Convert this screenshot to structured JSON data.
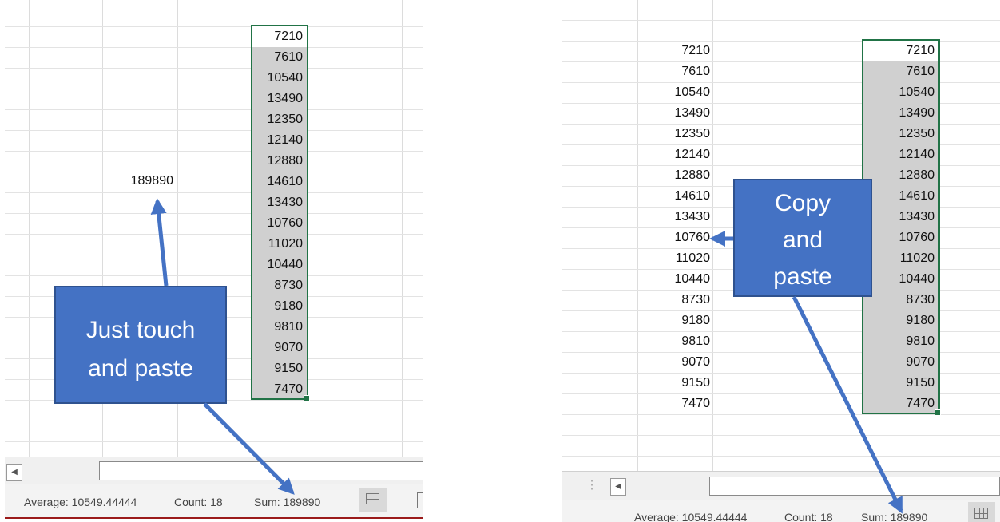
{
  "values": [
    "7210",
    "7610",
    "10540",
    "13490",
    "12350",
    "12140",
    "12880",
    "14610",
    "13430",
    "10760",
    "11020",
    "10440",
    "8730",
    "9180",
    "9810",
    "9070",
    "9150",
    "7470"
  ],
  "left": {
    "sum_cell": "189890",
    "callout": [
      "Just touch",
      "and paste"
    ],
    "status": {
      "average": "Average: 10549.44444",
      "count": "Count: 18",
      "sum": "Sum: 189890"
    }
  },
  "right": {
    "callout": [
      "Copy",
      "and",
      "paste"
    ],
    "status": {
      "average": "Average: 10549.44444",
      "count": "Count: 18",
      "sum": "Sum: 189890"
    }
  },
  "colors": {
    "callout_fill": "#4472c4",
    "arrow": "#4472c4",
    "selection_border": "#217346",
    "selected_cell": "#d0d0d0"
  },
  "icons": {
    "scroll_left": "triangle-left-icon",
    "normal_view": "grid-view-icon"
  }
}
